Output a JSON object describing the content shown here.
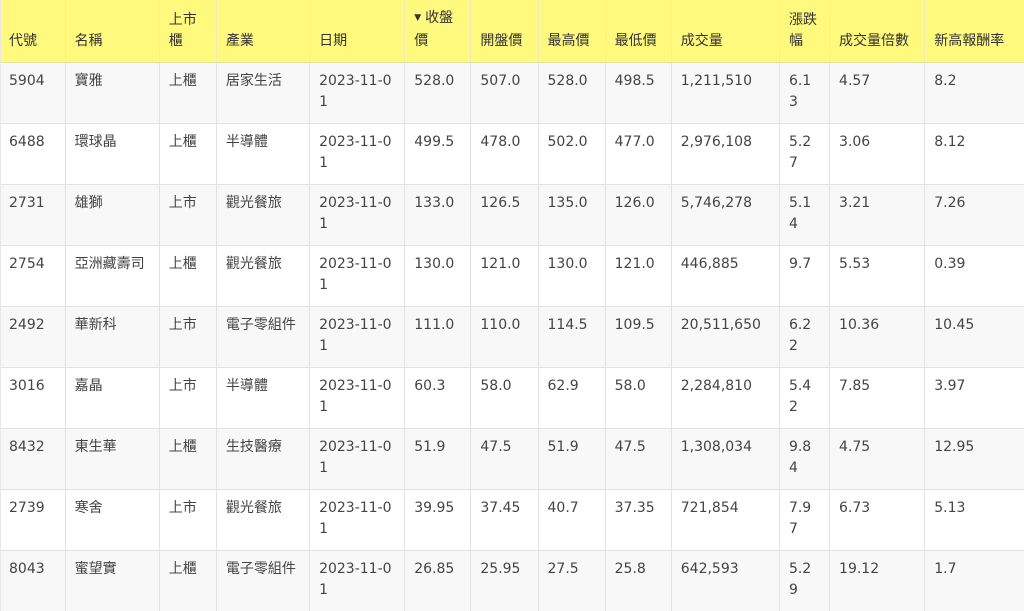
{
  "table": {
    "columns": [
      {
        "key": "code",
        "label": "代號"
      },
      {
        "key": "name",
        "label": "名稱"
      },
      {
        "key": "market",
        "label": "上市櫃"
      },
      {
        "key": "industry",
        "label": "產業"
      },
      {
        "key": "date",
        "label": "日期"
      },
      {
        "key": "close",
        "label": "收盤價",
        "sort_indicator": "▼"
      },
      {
        "key": "open",
        "label": "開盤價"
      },
      {
        "key": "high",
        "label": "最高價"
      },
      {
        "key": "low",
        "label": "最低價"
      },
      {
        "key": "volume",
        "label": "成交量"
      },
      {
        "key": "change_pct",
        "label": "漲跌幅"
      },
      {
        "key": "volume_ratio",
        "label": "成交量倍數"
      },
      {
        "key": "new_high_return",
        "label": "新高報酬率"
      }
    ],
    "rows": [
      {
        "code": "5904",
        "name": "寶雅",
        "market": "上櫃",
        "industry": "居家生活",
        "date": "2023-11-01",
        "close": "528.0",
        "open": "507.0",
        "high": "528.0",
        "low": "498.5",
        "volume": "1,211,510",
        "change_pct": "6.13",
        "volume_ratio": "4.57",
        "new_high_return": "8.2"
      },
      {
        "code": "6488",
        "name": "環球晶",
        "market": "上櫃",
        "industry": "半導體",
        "date": "2023-11-01",
        "close": "499.5",
        "open": "478.0",
        "high": "502.0",
        "low": "477.0",
        "volume": "2,976,108",
        "change_pct": "5.27",
        "volume_ratio": "3.06",
        "new_high_return": "8.12"
      },
      {
        "code": "2731",
        "name": "雄獅",
        "market": "上市",
        "industry": "觀光餐旅",
        "date": "2023-11-01",
        "close": "133.0",
        "open": "126.5",
        "high": "135.0",
        "low": "126.0",
        "volume": "5,746,278",
        "change_pct": "5.14",
        "volume_ratio": "3.21",
        "new_high_return": "7.26"
      },
      {
        "code": "2754",
        "name": "亞洲藏壽司",
        "market": "上櫃",
        "industry": "觀光餐旅",
        "date": "2023-11-01",
        "close": "130.0",
        "open": "121.0",
        "high": "130.0",
        "low": "121.0",
        "volume": "446,885",
        "change_pct": "9.7",
        "volume_ratio": "5.53",
        "new_high_return": "0.39"
      },
      {
        "code": "2492",
        "name": "華新科",
        "market": "上市",
        "industry": "電子零組件",
        "date": "2023-11-01",
        "close": "111.0",
        "open": "110.0",
        "high": "114.5",
        "low": "109.5",
        "volume": "20,511,650",
        "change_pct": "6.22",
        "volume_ratio": "10.36",
        "new_high_return": "10.45"
      },
      {
        "code": "3016",
        "name": "嘉晶",
        "market": "上市",
        "industry": "半導體",
        "date": "2023-11-01",
        "close": "60.3",
        "open": "58.0",
        "high": "62.9",
        "low": "58.0",
        "volume": "2,284,810",
        "change_pct": "5.42",
        "volume_ratio": "7.85",
        "new_high_return": "3.97"
      },
      {
        "code": "8432",
        "name": "東生華",
        "market": "上櫃",
        "industry": "生技醫療",
        "date": "2023-11-01",
        "close": "51.9",
        "open": "47.5",
        "high": "51.9",
        "low": "47.5",
        "volume": "1,308,034",
        "change_pct": "9.84",
        "volume_ratio": "4.75",
        "new_high_return": "12.95"
      },
      {
        "code": "2739",
        "name": "寒舍",
        "market": "上市",
        "industry": "觀光餐旅",
        "date": "2023-11-01",
        "close": "39.95",
        "open": "37.45",
        "high": "40.7",
        "low": "37.35",
        "volume": "721,854",
        "change_pct": "7.97",
        "volume_ratio": "6.73",
        "new_high_return": "5.13"
      },
      {
        "code": "8043",
        "name": "蜜望實",
        "market": "上櫃",
        "industry": "電子零組件",
        "date": "2023-11-01",
        "close": "26.85",
        "open": "25.95",
        "high": "27.5",
        "low": "25.8",
        "volume": "642,593",
        "change_pct": "5.29",
        "volume_ratio": "19.12",
        "new_high_return": "1.7"
      }
    ]
  },
  "colors": {
    "header_bg": "#fff97e",
    "row_odd_bg": "#f8f8f8",
    "row_even_bg": "#ffffff",
    "border": "#e2e2e2",
    "text": "#444444"
  },
  "icons": {
    "sort": "sort-desc-icon"
  }
}
